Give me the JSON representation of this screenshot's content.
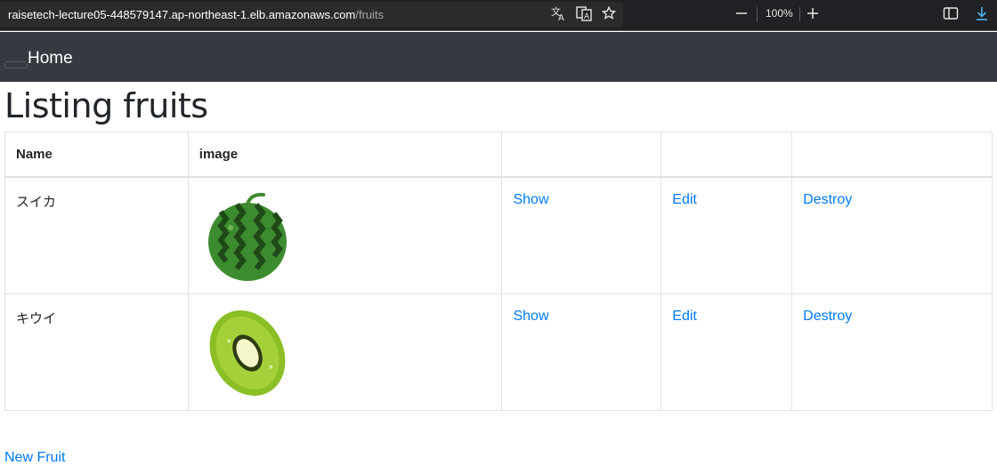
{
  "browser": {
    "url_host": "raisetech-lecture05-448579147.ap-northeast-1.elb.amazonaws.com",
    "url_path": "/fruits",
    "zoom": "100%",
    "icons": [
      "translate-icon",
      "read-aloud-icon",
      "star-icon",
      "zoom-out-icon",
      "zoom-in-icon",
      "split-screen-icon",
      "download-icon"
    ]
  },
  "navbar": {
    "home_label": "Home"
  },
  "page": {
    "title": "Listing fruits"
  },
  "table": {
    "headers": [
      "Name",
      "image",
      "",
      "",
      ""
    ],
    "rows": [
      {
        "name": "スイカ",
        "image": "watermelon",
        "show": "Show",
        "edit": "Edit",
        "destroy": "Destroy"
      },
      {
        "name": "キウイ",
        "image": "kiwi",
        "show": "Show",
        "edit": "Edit",
        "destroy": "Destroy"
      }
    ]
  },
  "footer": {
    "new_link": "New Fruit"
  },
  "colors": {
    "navbar": "#343a40",
    "link": "#007bff",
    "border": "#dee2e6"
  }
}
